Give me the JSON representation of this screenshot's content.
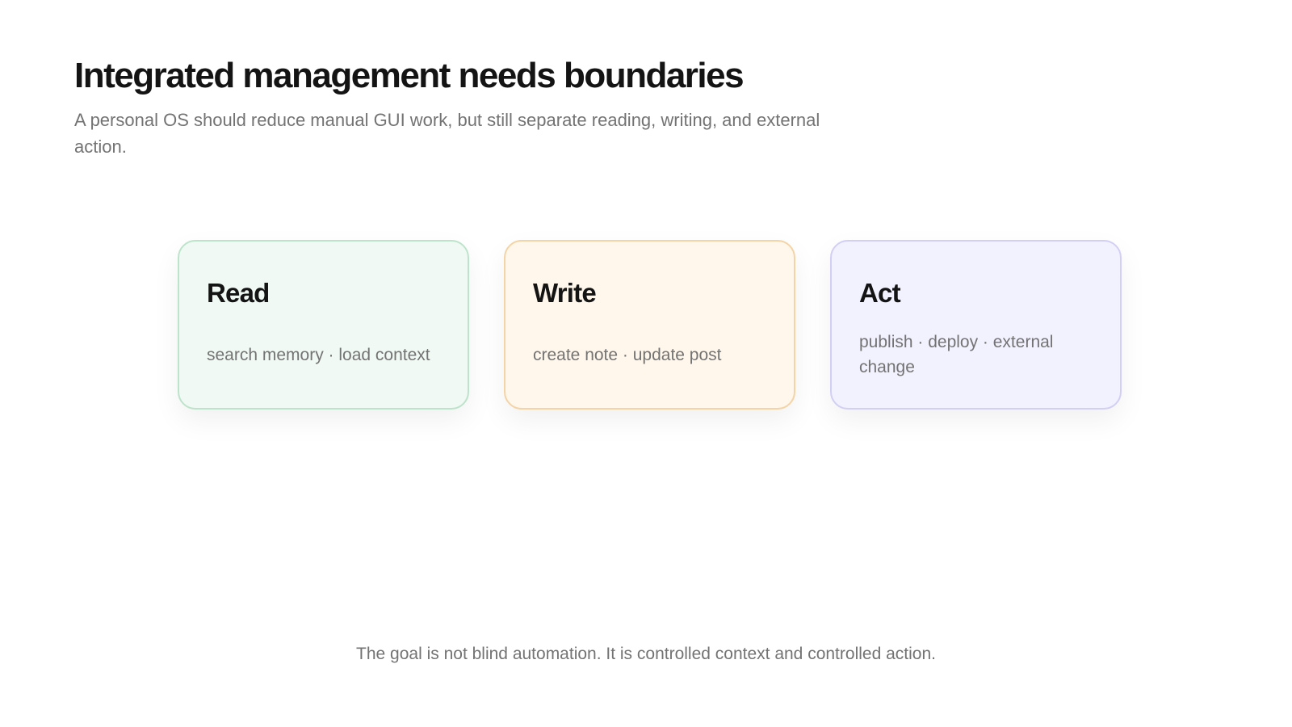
{
  "header": {
    "title": "Integrated management needs boundaries",
    "subtitle": "A personal OS should reduce manual GUI work, but still separate reading, writing, and external action."
  },
  "cards": [
    {
      "title": "Read",
      "body": "search memory · load context",
      "background": "#f0f9f4",
      "border": "#bde3cb"
    },
    {
      "title": "Write",
      "body": "create note · update post",
      "background": "#fff7ec",
      "border": "#f4d3a6"
    },
    {
      "title": "Act",
      "body": "publish · deploy · external change",
      "background": "#f2f1fe",
      "border": "#d2cff5"
    }
  ],
  "footer": {
    "text": "The goal is not blind automation. It is controlled context and controlled action."
  }
}
